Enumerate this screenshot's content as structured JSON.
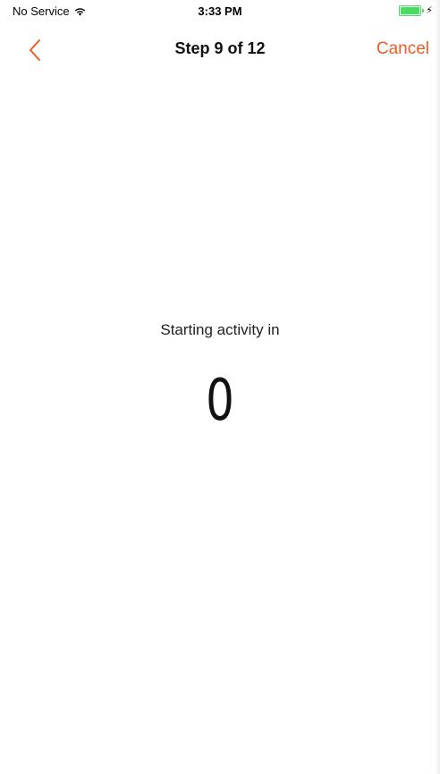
{
  "status_bar": {
    "carrier": "No Service",
    "time": "3:33 PM",
    "battery_color": "#4cd964"
  },
  "nav": {
    "back_icon": "chevron-left-icon",
    "title": "Step 9 of 12",
    "cancel_label": "Cancel",
    "accent_color": "#f05a28"
  },
  "main": {
    "countdown_label": "Starting activity in",
    "countdown_value": "0"
  }
}
